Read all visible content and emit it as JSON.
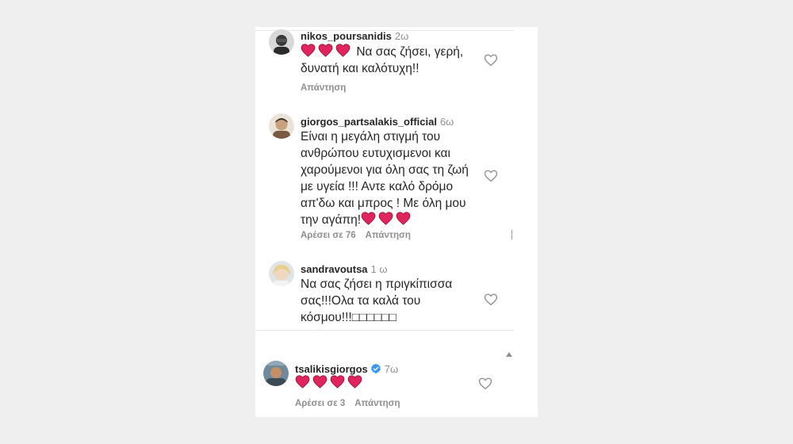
{
  "comments": [
    {
      "username": "nikos_poursanidis",
      "time": "2ω",
      "text": "Να σας ζήσει, γερή, δυνατή και καλότυχη!!",
      "hearts_before_text": 3,
      "reply_label": "Απάντηση"
    },
    {
      "username": "giorgos_partsalakis_official",
      "time": "6ω",
      "text": "Είναι η μεγάλη στιγμή του ανθρώπου ευτυχισμενοι και χαρούμενοι για όλη σας τη ζωή με υγεία !!! Αντε καλό δρόμο απ'δω και μπρος ! Με όλη μου την αγάπη!",
      "hearts_after_text": 3,
      "likes_label": "Αρέσει σε 76",
      "reply_label": "Απάντηση"
    },
    {
      "username": "sandravoutsa",
      "time": "1 ω",
      "text": "Να σας ζήσει η πριγκίπισσα σας!!!Ολα τα καλά του κόσμου!!!□□□□□□"
    },
    {
      "username": "tsalikisgiorgos",
      "verified": true,
      "time": "7ω",
      "hearts_only": 4,
      "likes_label": "Αρέσει σε 3",
      "reply_label": "Απάντηση"
    }
  ],
  "icons": {
    "like": "heart-outline-icon",
    "emoji": "red-heart-emoji-icon",
    "verified": "verified-badge-icon"
  },
  "colors": {
    "text": "#262626",
    "muted": "#8e8e8e",
    "heart": "#e0245e",
    "verified": "#3897f0"
  }
}
